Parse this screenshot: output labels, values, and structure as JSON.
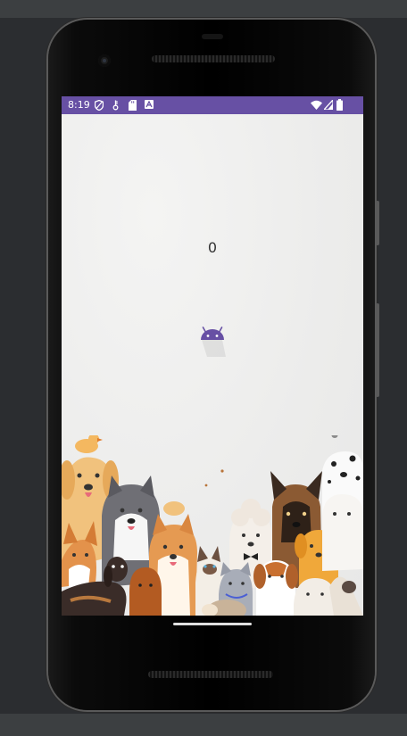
{
  "status_bar": {
    "time": "8:19",
    "color": "#6750a4",
    "left_icons": [
      "shield-icon",
      "vpn-key-icon",
      "sd-card-icon",
      "app-notification-icon"
    ],
    "right_icons": [
      "wifi-icon",
      "signal-icon",
      "battery-icon"
    ]
  },
  "game": {
    "score": "0",
    "player_icon": "android-robot-icon",
    "accent": "#6750a4"
  },
  "background": {
    "illustration": "watercolor-dogs-illustration",
    "color": "#ededec"
  }
}
